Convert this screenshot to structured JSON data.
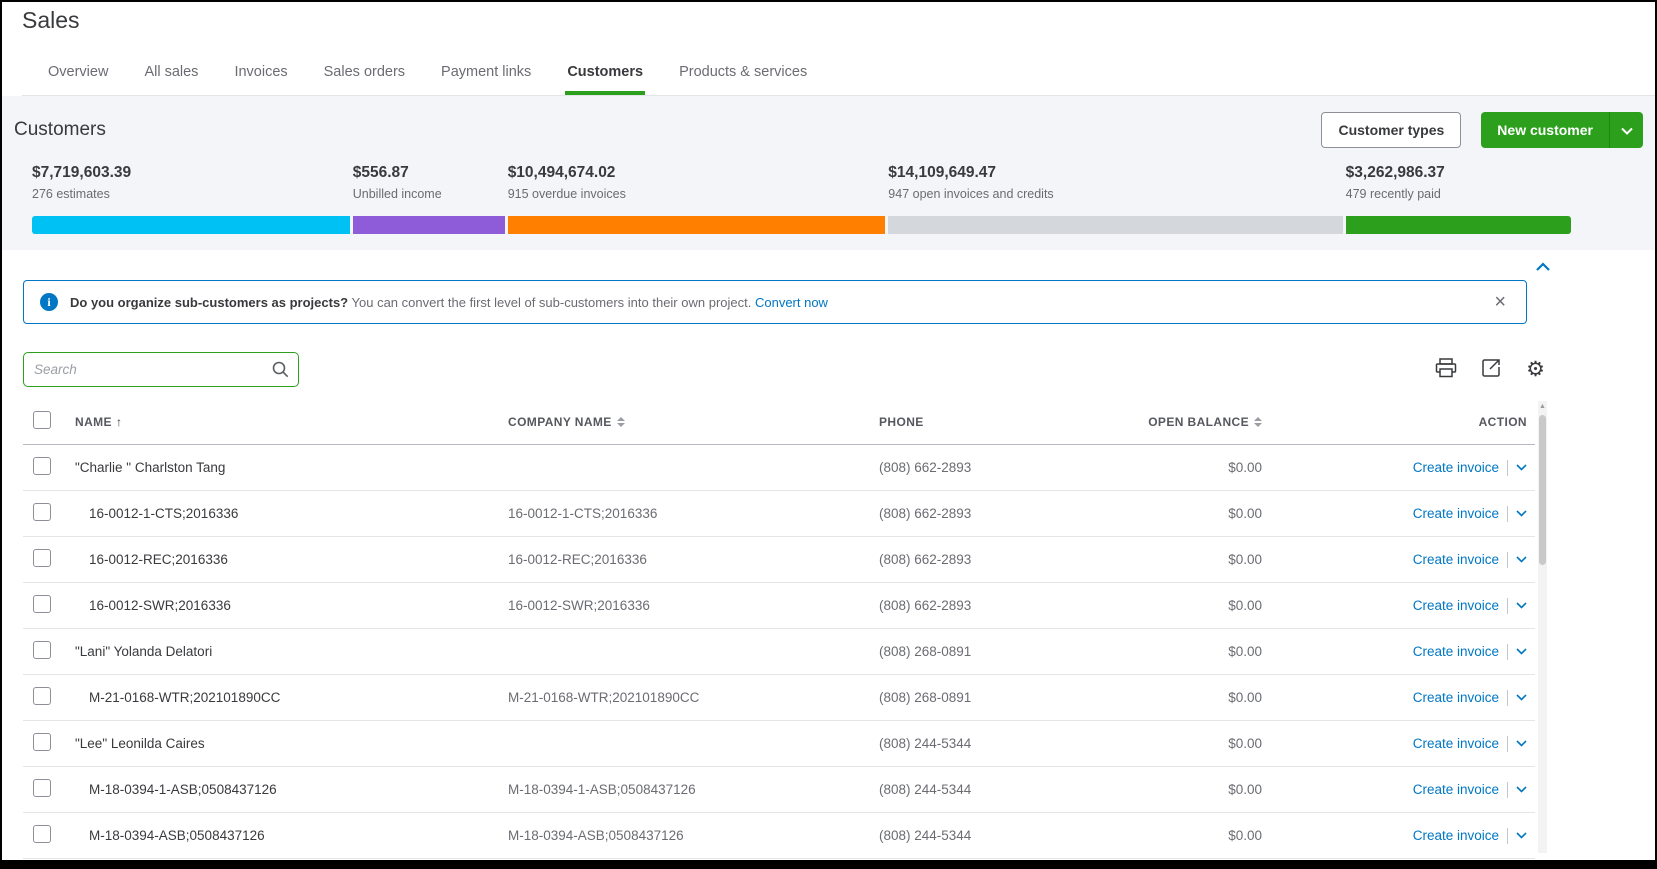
{
  "page": {
    "title": "Sales"
  },
  "tabs": [
    {
      "label": "Overview",
      "active": false
    },
    {
      "label": "All sales",
      "active": false
    },
    {
      "label": "Invoices",
      "active": false
    },
    {
      "label": "Sales orders",
      "active": false
    },
    {
      "label": "Payment links",
      "active": false
    },
    {
      "label": "Customers",
      "active": true
    },
    {
      "label": "Products & services",
      "active": false
    }
  ],
  "customers_header": {
    "title": "Customers",
    "customer_types_label": "Customer types",
    "new_customer_label": "New customer"
  },
  "money_bar": {
    "stats": [
      {
        "amount": "$7,719,603.39",
        "label": "276 estimates",
        "color": "#00C1F3",
        "width_pct": 20.7
      },
      {
        "amount": "$556.87",
        "label": "Unbilled income",
        "color": "#8F5CD9",
        "width_pct": 9.9
      },
      {
        "amount": "$10,494,674.02",
        "label": "915 overdue invoices",
        "color": "#FF8000",
        "width_pct": 24.6
      },
      {
        "amount": "$14,109,649.47",
        "label": "947 open invoices and credits",
        "color": "#D4D7DC",
        "width_pct": 29.6
      },
      {
        "amount": "$3,262,986.37",
        "label": "479 recently paid",
        "color": "#2CA01C",
        "width_pct": 14.7
      }
    ]
  },
  "banner": {
    "bold_text": "Do you organize sub-customers as projects?",
    "text": "You can convert the first level of sub-customers into their own project.",
    "link_label": "Convert now"
  },
  "toolbar": {
    "search_placeholder": "Search"
  },
  "icons": {
    "gear": "⚙",
    "close": "×",
    "sort_asc": "↑",
    "scroll_up": "▲"
  },
  "colors": {
    "accent_green": "#2CA01C",
    "link_blue": "#0077C5"
  },
  "table": {
    "columns": [
      "NAME",
      "COMPANY NAME",
      "PHONE",
      "OPEN BALANCE",
      "ACTION"
    ],
    "sorted_column": "NAME",
    "sort_direction": "asc",
    "action_label": "Create invoice",
    "rows": [
      {
        "name": "\"Charlie \" Charlston Tang",
        "company": "",
        "phone": "(808) 662-2893",
        "balance": "$0.00",
        "sub": false
      },
      {
        "name": "16-0012-1-CTS;2016336",
        "company": "16-0012-1-CTS;2016336",
        "phone": "(808) 662-2893",
        "balance": "$0.00",
        "sub": true
      },
      {
        "name": "16-0012-REC;2016336",
        "company": "16-0012-REC;2016336",
        "phone": "(808) 662-2893",
        "balance": "$0.00",
        "sub": true
      },
      {
        "name": "16-0012-SWR;2016336",
        "company": "16-0012-SWR;2016336",
        "phone": "(808) 662-2893",
        "balance": "$0.00",
        "sub": true
      },
      {
        "name": "\"Lani\" Yolanda Delatori",
        "company": "",
        "phone": "(808) 268-0891",
        "balance": "$0.00",
        "sub": false
      },
      {
        "name": "M-21-0168-WTR;202101890CC",
        "company": "M-21-0168-WTR;202101890CC",
        "phone": "(808) 268-0891",
        "balance": "$0.00",
        "sub": true
      },
      {
        "name": "\"Lee\" Leonilda Caires",
        "company": "",
        "phone": "(808) 244-5344",
        "balance": "$0.00",
        "sub": false
      },
      {
        "name": "M-18-0394-1-ASB;0508437126",
        "company": "M-18-0394-1-ASB;0508437126",
        "phone": "(808) 244-5344",
        "balance": "$0.00",
        "sub": true
      },
      {
        "name": "M-18-0394-ASB;0508437126",
        "company": "M-18-0394-ASB;0508437126",
        "phone": "(808) 244-5344",
        "balance": "$0.00",
        "sub": true
      }
    ]
  }
}
